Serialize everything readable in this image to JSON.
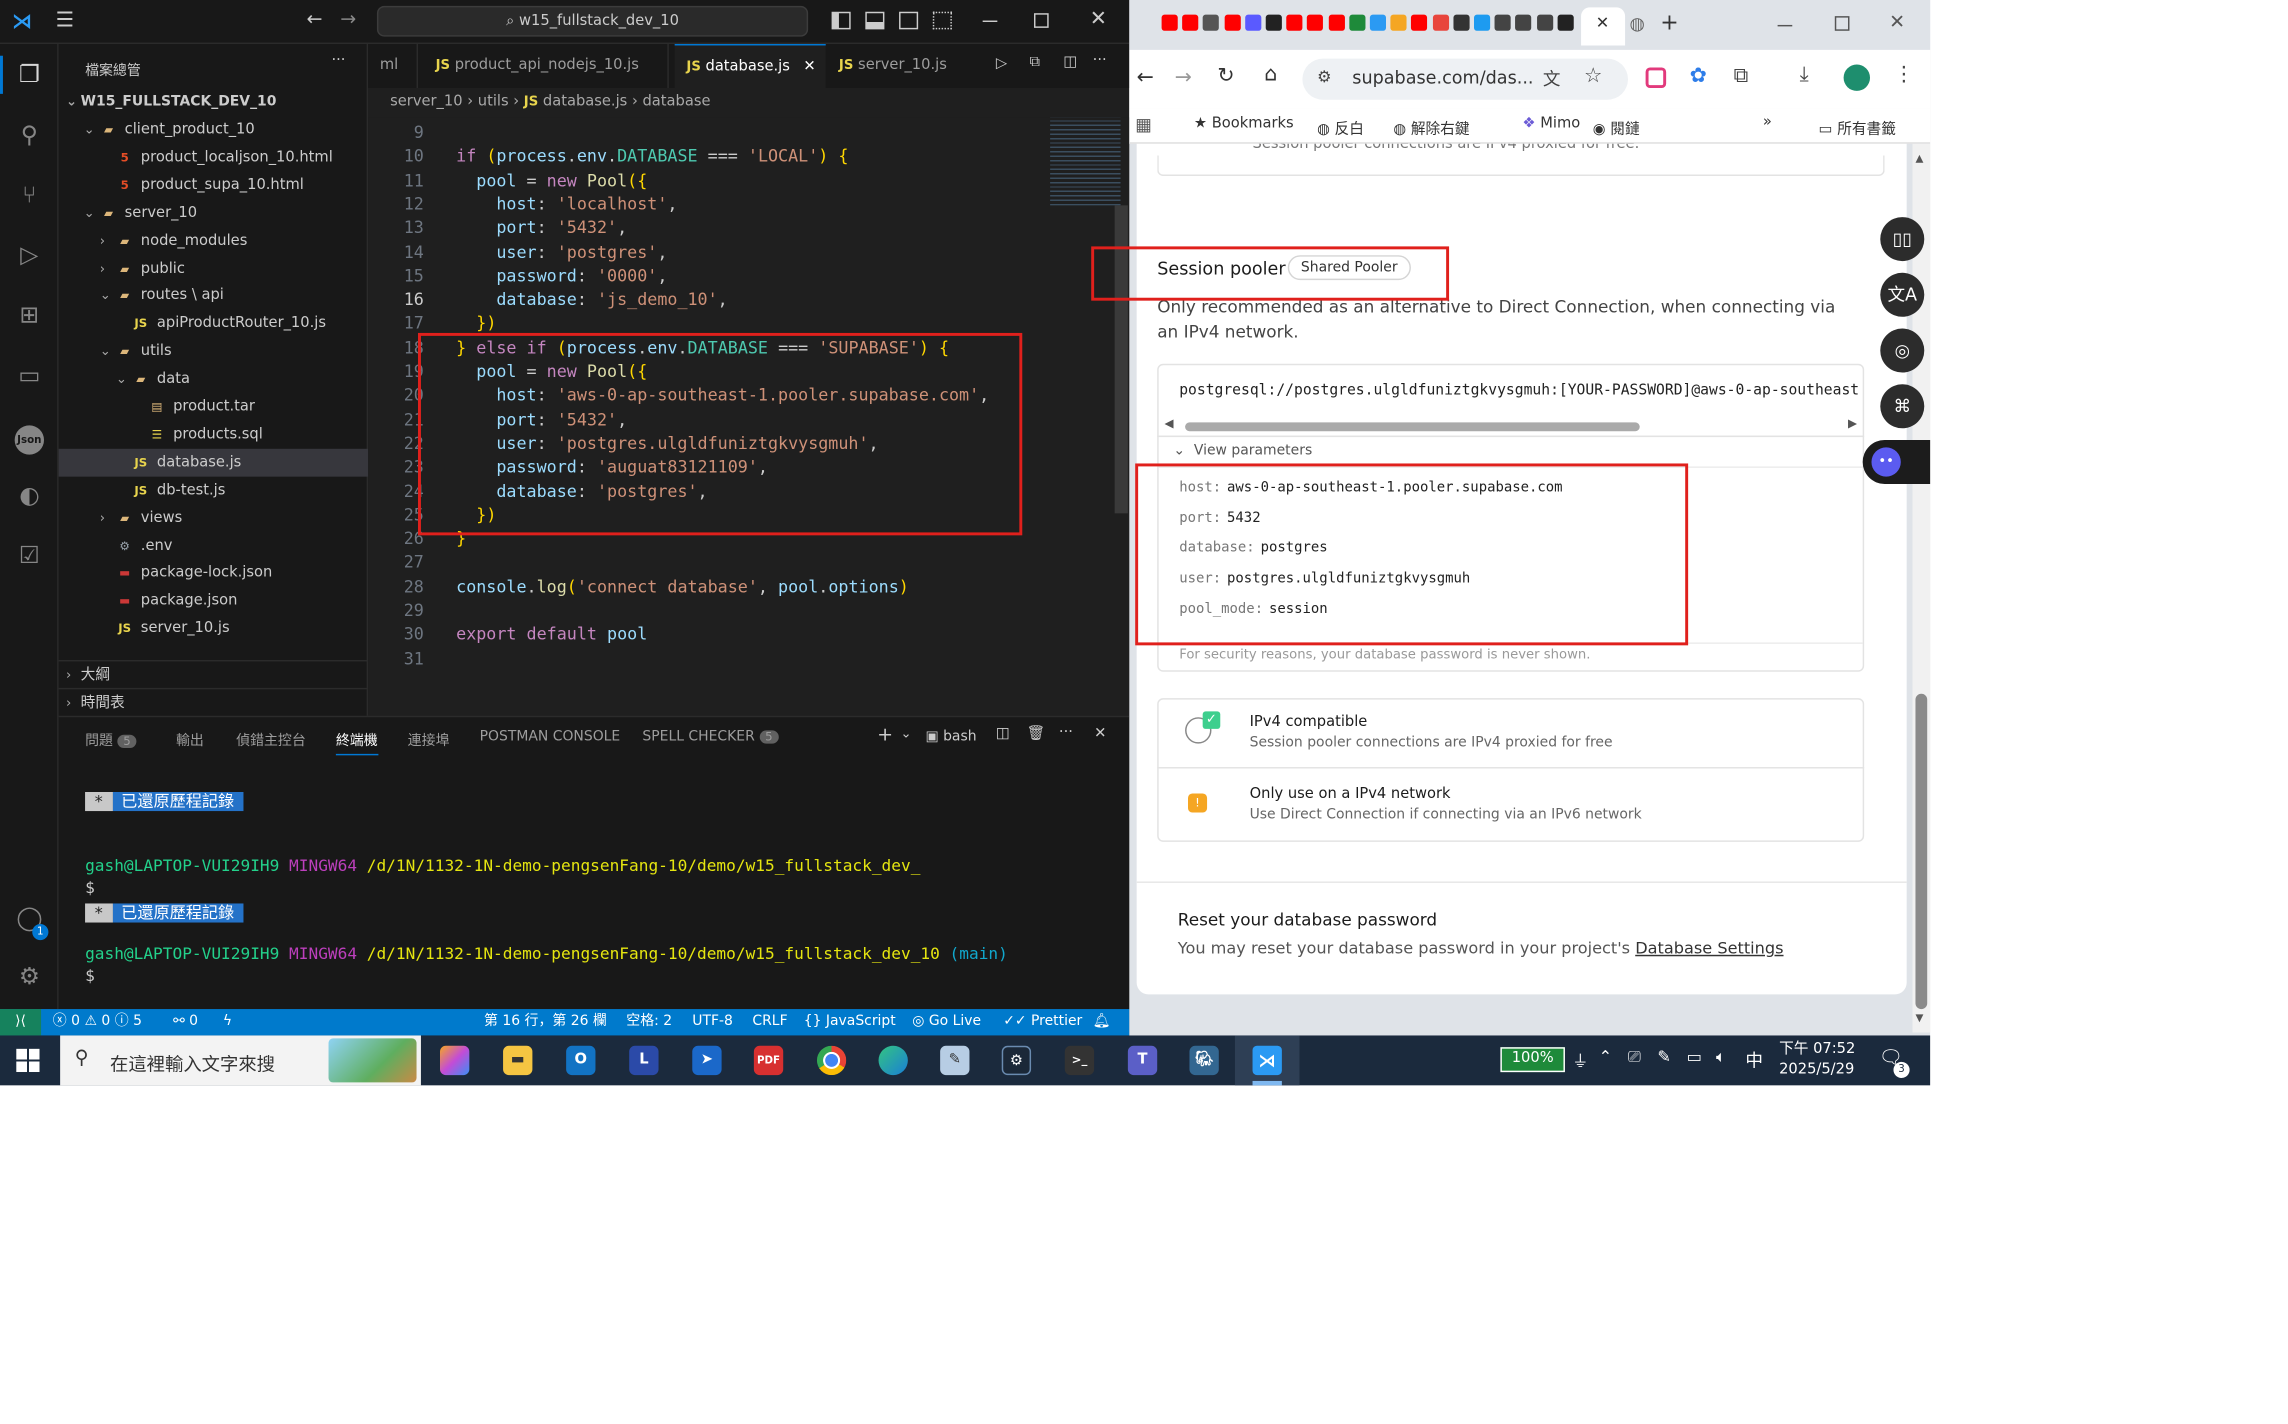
{
  "vscode": {
    "search_text": "w15_fullstack_dev_10",
    "explorer_title": "檔案總管",
    "project_root": "W15_FULLSTACK_DEV_10",
    "tree": [
      {
        "label": "client_product_10",
        "type": "folder"
      },
      {
        "label": "product_localjson_10.html",
        "type": "html"
      },
      {
        "label": "product_supa_10.html",
        "type": "html"
      },
      {
        "label": "server_10",
        "type": "folder"
      },
      {
        "label": "node_modules",
        "type": "folder"
      },
      {
        "label": "public",
        "type": "folder"
      },
      {
        "label": "routes \\ api",
        "type": "folder"
      },
      {
        "label": "apiProductRouter_10.js",
        "type": "js"
      },
      {
        "label": "utils",
        "type": "folder"
      },
      {
        "label": "data",
        "type": "folder"
      },
      {
        "label": "product.tar",
        "type": "file"
      },
      {
        "label": "products.sql",
        "type": "sql"
      },
      {
        "label": "database.js",
        "type": "js"
      },
      {
        "label": "db-test.js",
        "type": "js"
      },
      {
        "label": "views",
        "type": "folder"
      },
      {
        "label": ".env",
        "type": "gear"
      },
      {
        "label": "package-lock.json",
        "type": "npm"
      },
      {
        "label": "package.json",
        "type": "npm"
      },
      {
        "label": "server_10.js",
        "type": "js"
      }
    ],
    "outline_label": "大綱",
    "timeline_label": "時間表",
    "tabs": [
      {
        "label": "ml"
      },
      {
        "label": "product_api_nodejs_10.js",
        "badge": "JS"
      },
      {
        "label": "database.js",
        "badge": "JS"
      },
      {
        "label": "server_10.js",
        "badge": "JS"
      }
    ],
    "breadcrumb": [
      "server_10",
      "utils",
      "database.js",
      "database"
    ],
    "code_lines": [
      {
        "n": "9",
        "t": ""
      },
      {
        "n": "10",
        "t": "if (process.env.DATABASE === 'LOCAL') {"
      },
      {
        "n": "11",
        "t": "  pool = new Pool({"
      },
      {
        "n": "12",
        "t": "    host: 'localhost',"
      },
      {
        "n": "13",
        "t": "    port: '5432',"
      },
      {
        "n": "14",
        "t": "    user: 'postgres',"
      },
      {
        "n": "15",
        "t": "    password: '0000',"
      },
      {
        "n": "16",
        "t": "    database: 'js_demo_10',"
      },
      {
        "n": "17",
        "t": "  })"
      },
      {
        "n": "18",
        "t": "} else if (process.env.DATABASE === 'SUPABASE') {"
      },
      {
        "n": "19",
        "t": "  pool = new Pool({"
      },
      {
        "n": "20",
        "t": "    host: 'aws-0-ap-southeast-1.pooler.supabase.com',"
      },
      {
        "n": "21",
        "t": "    port: '5432',"
      },
      {
        "n": "22",
        "t": "    user: 'postgres.ulgldfuniztgkvysgmuh',"
      },
      {
        "n": "23",
        "t": "    password: 'auguat83121109',"
      },
      {
        "n": "24",
        "t": "    database: 'postgres',"
      },
      {
        "n": "25",
        "t": "  })"
      },
      {
        "n": "26",
        "t": "}"
      },
      {
        "n": "27",
        "t": ""
      },
      {
        "n": "28",
        "t": "console.log('connect database', pool.options)"
      },
      {
        "n": "29",
        "t": ""
      },
      {
        "n": "30",
        "t": "export default pool"
      },
      {
        "n": "31",
        "t": ""
      }
    ],
    "panel_tabs": [
      {
        "label": "問題",
        "badge": "5"
      },
      {
        "label": "輸出"
      },
      {
        "label": "偵錯主控台"
      },
      {
        "label": "終端機"
      },
      {
        "label": "連接埠"
      },
      {
        "label": "POSTMAN CONSOLE"
      },
      {
        "label": "SPELL CHECKER",
        "badge": "5"
      }
    ],
    "terminal_shell": "bash",
    "terminal": {
      "restored": "已還原歷程記錄",
      "restored_mark": "*",
      "prompt_user": "gash@LAPTOP-VUI29IH9",
      "prompt_env": "MINGW64",
      "path1": "/d/1N/1132-1N-demo-pengsenFang-10/demo/w15_fullstack_dev_",
      "path2": "/d/1N/1132-1N-demo-pengsenFang-10/demo/w15_fullstack_dev_10",
      "branch": "(main)",
      "dollar": "$"
    },
    "status": {
      "errors": "0",
      "warnings": "0",
      "info": "5",
      "ports": "0",
      "position": "第 16 行，第 26 欄",
      "spaces": "空格: 2",
      "encoding": "UTF-8",
      "eol": "CRLF",
      "language": "JavaScript",
      "golive": "Go Live",
      "prettier": "Prettier"
    }
  },
  "browser": {
    "url": "supabase.com/das...",
    "bookmarks": [
      "Bookmarks",
      "反白",
      "解除右鍵",
      "Mimo",
      "閱鏈"
    ],
    "all_bookmarks": "所有書籤",
    "top_text": "Session pooler connections are IPv4 proxied for free.",
    "session_pooler": "Session pooler",
    "shared_pooler": "Shared Pooler",
    "pooler_desc": "Only recommended as an alternative to Direct Connection, when connecting via an IPv4 network.",
    "conn_string": "postgresql://postgres.ulgldfuniztgkvysgmuh:[YOUR-PASSWORD]@aws-0-ap-southeast",
    "view_params": "View parameters",
    "params": [
      {
        "k": "host:",
        "v": "aws-0-ap-southeast-1.pooler.supabase.com"
      },
      {
        "k": "port:",
        "v": "5432"
      },
      {
        "k": "database:",
        "v": "postgres"
      },
      {
        "k": "user:",
        "v": "postgres.ulgldfuniztgkvysgmuh"
      },
      {
        "k": "pool_mode:",
        "v": "session"
      }
    ],
    "security_note": "For security reasons, your database password is never shown.",
    "ipv4_title": "IPv4 compatible",
    "ipv4_desc": "Session pooler connections are IPv4 proxied for free",
    "only_title": "Only use on a IPv4 network",
    "only_desc": "Use Direct Connection if connecting via an IPv6 network",
    "reset_title": "Reset your database password",
    "reset_desc": "You may reset your database password in your project's",
    "reset_link": "Database Settings"
  },
  "taskbar": {
    "search_placeholder": "在這裡輸入文字來搜",
    "battery": "100%",
    "ime": "中",
    "time": "下午 07:52",
    "date": "2025/5/29",
    "notif_count": "3"
  },
  "colors": {
    "vscode_blue": "#007acc",
    "highlight_red": "#e0201c",
    "supabase_green": "#3ecf8e"
  }
}
